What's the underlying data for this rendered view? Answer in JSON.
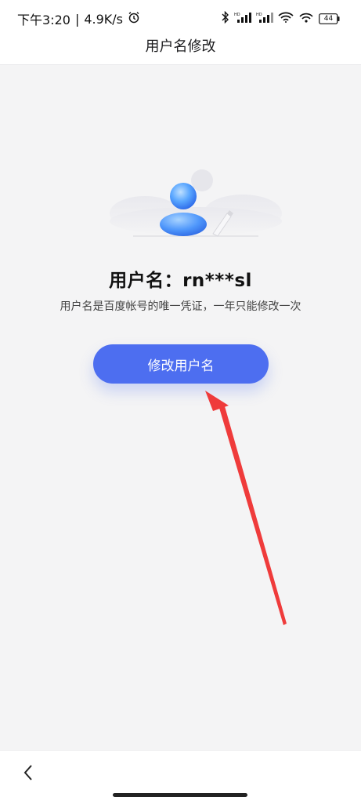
{
  "status_bar": {
    "time": "下午3:20",
    "separator": "|",
    "speed": "4.9K/s",
    "battery": "44",
    "icons": [
      "alarm-icon",
      "bluetooth-icon",
      "signal-hd-icon",
      "signal-hd-icon",
      "wifi-icon",
      "hotspot-icon",
      "battery-icon"
    ]
  },
  "header": {
    "title": "用户名修改"
  },
  "main": {
    "username_label": "用户名：rn***sl",
    "hint": "用户名是百度帐号的唯一凭证，一年只能修改一次",
    "modify_button_label": "修改用户名"
  },
  "nav": {
    "back_icon": "chevron-left-icon"
  },
  "colors": {
    "accent": "#4d6ef0",
    "annotation_arrow": "#ef3b3b",
    "background": "#f4f4f5"
  }
}
